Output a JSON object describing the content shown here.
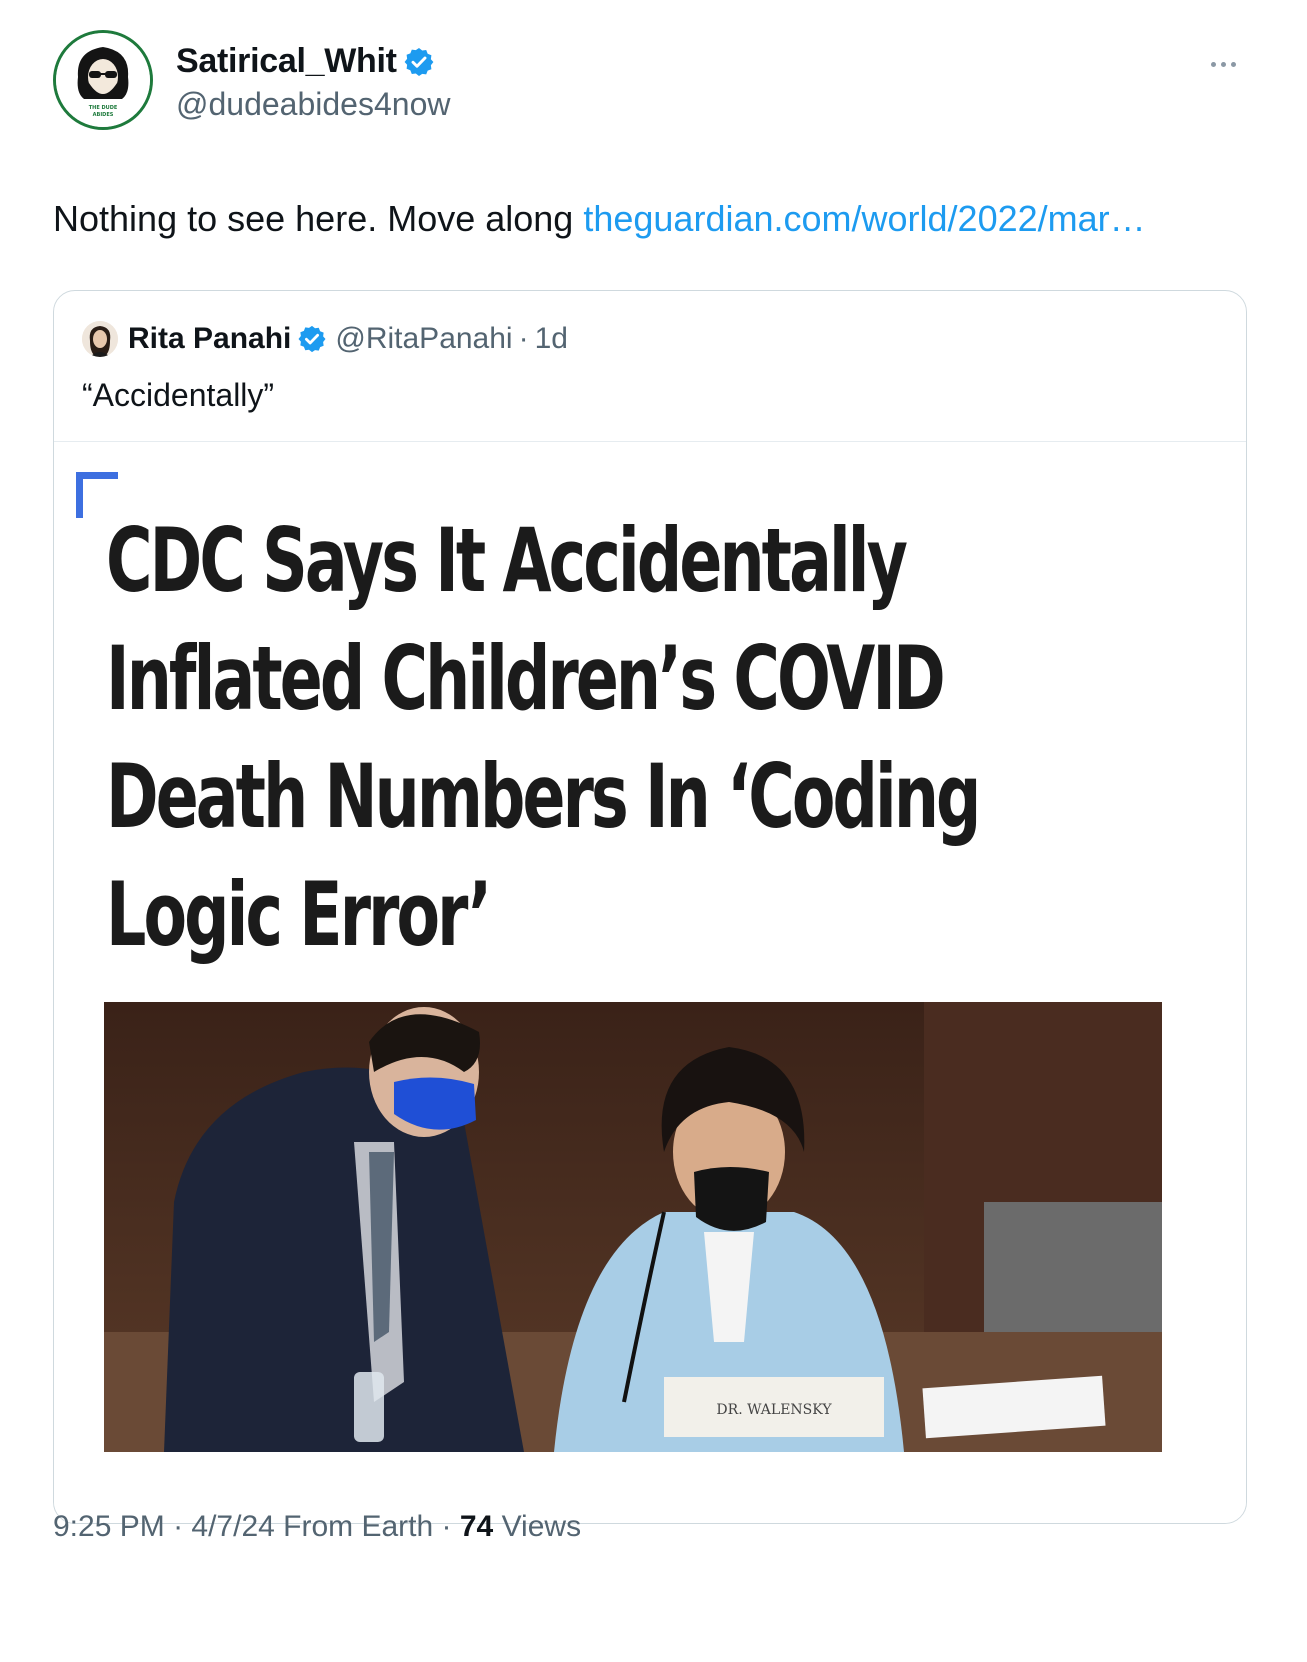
{
  "tweet": {
    "author": {
      "name": "Satirical_Whit",
      "handle": "@dudeabides4now",
      "avatar_icon": "dude-abides-avatar",
      "verified": true
    },
    "text": "Nothing to see here. Move along ",
    "link_text": "theguardian.com/world/2022/mar…",
    "more_icon": "more-dots-icon"
  },
  "quoted_tweet": {
    "author": {
      "name": "Rita Panahi",
      "handle": "@RitaPanahi",
      "verified": true
    },
    "separator": "·",
    "time": "1d",
    "text": "“Accidentally”",
    "image": {
      "headline_lines": [
        "CDC Says It Accidentally",
        "Inflated Children’s COVID",
        "Death Numbers In ‘Coding",
        "Logic Error’"
      ],
      "nameplate": "DR. WALENSKY"
    }
  },
  "meta": {
    "time": "9:25 PM",
    "sep1": " · ",
    "date": "4/7/24",
    "source": " From Earth",
    "sep2": " · ",
    "views_count": "74",
    "views_label": " Views"
  },
  "colors": {
    "link": "#1d9bf0",
    "verified": "#1d9bf0",
    "muted_text": "#536471",
    "headline_accent": "#3d6fe0"
  }
}
